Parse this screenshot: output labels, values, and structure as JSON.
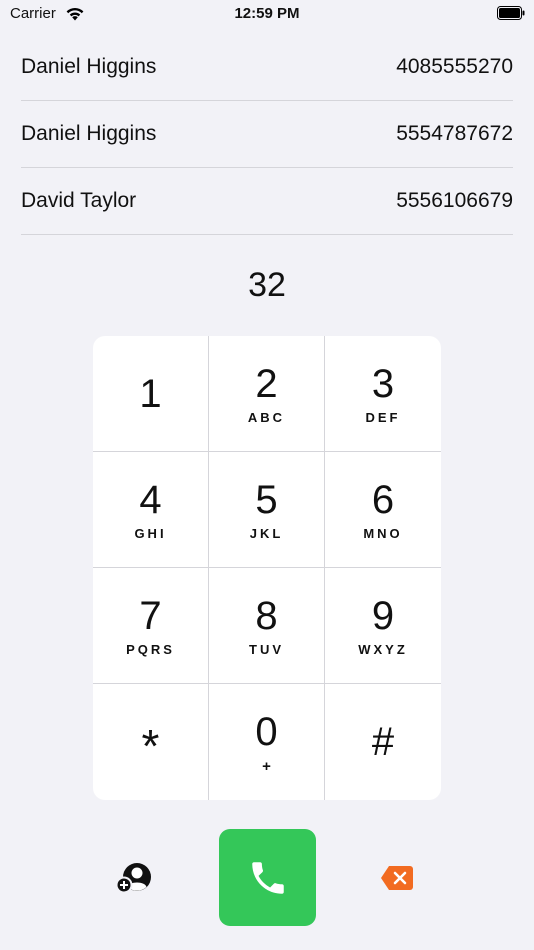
{
  "status_bar": {
    "carrier": "Carrier",
    "time": "12:59 PM"
  },
  "contacts": [
    {
      "name": "Daniel Higgins",
      "number": "4085555270"
    },
    {
      "name": "Daniel Higgins",
      "number": "5554787672"
    },
    {
      "name": "David Taylor",
      "number": "5556106679"
    }
  ],
  "typed_number": "32",
  "keypad": [
    {
      "digit": "1",
      "letters": ""
    },
    {
      "digit": "2",
      "letters": "ABC"
    },
    {
      "digit": "3",
      "letters": "DEF"
    },
    {
      "digit": "4",
      "letters": "GHI"
    },
    {
      "digit": "5",
      "letters": "JKL"
    },
    {
      "digit": "6",
      "letters": "MNO"
    },
    {
      "digit": "7",
      "letters": "PQRS"
    },
    {
      "digit": "8",
      "letters": "TUV"
    },
    {
      "digit": "9",
      "letters": "WXYZ"
    },
    {
      "digit": "*",
      "letters": ""
    },
    {
      "digit": "0",
      "letters": "+"
    },
    {
      "digit": "#",
      "letters": ""
    }
  ],
  "colors": {
    "background": "#f2f2f7",
    "call_green": "#34c759",
    "delete_orange": "#f26b21"
  },
  "icons": {
    "add_contact": "add-contact-icon",
    "call": "phone-icon",
    "delete": "delete-backspace-icon"
  }
}
